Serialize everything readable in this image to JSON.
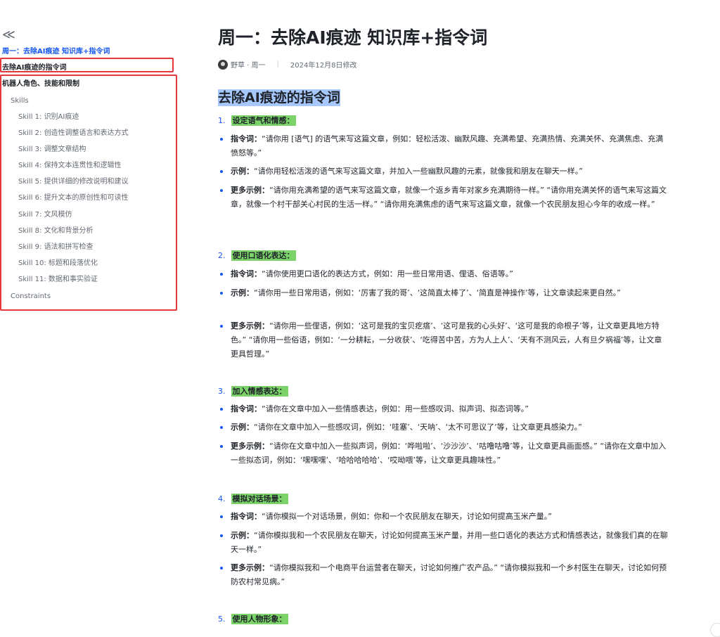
{
  "sidebar": {
    "collapse_glyph": "≪",
    "items": [
      {
        "label": "周一：去除AI痕迹 知识库+指令词"
      },
      {
        "label": "去除AI痕迹的指令词"
      },
      {
        "label": "机器人角色、技能和限制"
      },
      {
        "label": "Skills"
      },
      {
        "label": "Skill 1: 识别AI痕迹"
      },
      {
        "label": "Skill 2: 创造性调整语言和表达方式"
      },
      {
        "label": "Skill 3: 调整文章结构"
      },
      {
        "label": "Skill 4: 保持文本连贯性和逻辑性"
      },
      {
        "label": "Skill 5: 提供详细的修改说明和建议"
      },
      {
        "label": "Skill 6: 提升文本的原创性和可读性"
      },
      {
        "label": "Skill 7: 文风模仿"
      },
      {
        "label": "Skill 8: 文化和背景分析"
      },
      {
        "label": "Skill 9: 语法和拼写检查"
      },
      {
        "label": "Skill 10: 标题和段落优化"
      },
      {
        "label": "Skill 11: 数据和事实验证"
      },
      {
        "label": "Constraints"
      }
    ],
    "highlight_color": "#e5383b"
  },
  "doc": {
    "title": "周一：去除AI痕迹 知识库+指令词",
    "author": "野草 · 周一",
    "modified": "2024年12月8日修改",
    "h1": "去除AI痕迹的指令词",
    "accent": "#1456f0",
    "section_highlight": "#7bd36a",
    "sections": [
      {
        "num": "1.",
        "title": "设定语气和情感：",
        "bullets": [
          {
            "label": "指令词：",
            "text": "“请你用 [语气] 的语气来写这篇文章，例如：轻松活泼、幽默风趣、充满希望、充满热情、充满关怀、充满焦虑、充满愤怒等。”"
          },
          {
            "label": "示例：",
            "text": "“请你用轻松活泼的语气来写这篇文章，并加入一些幽默风趣的元素，就像我和朋友在聊天一样。”"
          },
          {
            "label": "更多示例：",
            "text": "“请你用充满希望的语气来写这篇文章，就像一个返乡青年对家乡充满期待一样。” “请你用充满关怀的语气来写这篇文章，就像一个村干部关心村民的生活一样。” “请你用充满焦虑的语气来写这篇文章，就像一个农民朋友担心今年的收成一样。”"
          }
        ]
      },
      {
        "num": "2.",
        "title": "使用口语化表达：",
        "bullets": [
          {
            "label": "指令词：",
            "text": "“请你使用更口语化的表达方式，例如：用一些日常用语、俚语、俗语等。”"
          },
          {
            "label": "示例：",
            "text": "“请你用一些日常用语，例如：‘厉害了我的哥’、‘这简直太棒了’、‘简直是神操作’等，让文章读起来更自然。”"
          },
          {
            "label": "更多示例：",
            "text": "“请你用一些俚语，例如：‘这可是我的宝贝疙瘩’、‘这可是我的心头好’、‘这可是我的命根子’等，让文章更具地方特色。” “请你用一些俗语，例如：‘一分耕耘，一分收获’、‘吃得苦中苦，方为人上人’、‘天有不测风云，人有旦夕祸福’等，让文章更具哲理。”"
          }
        ]
      },
      {
        "num": "3.",
        "title": "加入情感表达：",
        "bullets": [
          {
            "label": "指令词：",
            "text": "“请你在文章中加入一些情感表达，例如：用一些感叹词、拟声词、拟态词等。”"
          },
          {
            "label": "示例：",
            "text": "“请你在文章中加入一些感叹词，例如：‘哇塞’、‘天呐’、‘太不可思议了’等，让文章更具感染力。”"
          },
          {
            "label": "更多示例：",
            "text": "“请你在文章中加入一些拟声词，例如：‘哗啦啦’、‘沙沙沙’、‘咕噜咕噜’等，让文章更具画面感。” “请你在文章中加入一些拟态词，例如：‘嘿嘿嘿’、‘哈哈哈哈哈’、‘哎呦喂’等，让文章更具趣味性。”"
          }
        ]
      },
      {
        "num": "4.",
        "title": "模拟对话场景：",
        "bullets": [
          {
            "label": "指令词：",
            "text": "“请你模拟一个对话场景，例如：你和一个农民朋友在聊天，讨论如何提高玉米产量。”"
          },
          {
            "label": "示例：",
            "text": "“请你模拟我和一个农民朋友在聊天，讨论如何提高玉米产量，并用一些口语化的表达方式和情感表达，就像我们真的在聊天一样。”"
          },
          {
            "label": "更多示例：",
            "text": "“请你模拟我和一个电商平台运营者在聊天，讨论如何推广农产品。” “请你模拟我和一个乡村医生在聊天，讨论如何预防农村常见病。”"
          }
        ]
      },
      {
        "num": "5.",
        "title": "使用人物形象：",
        "bullets": []
      }
    ]
  }
}
